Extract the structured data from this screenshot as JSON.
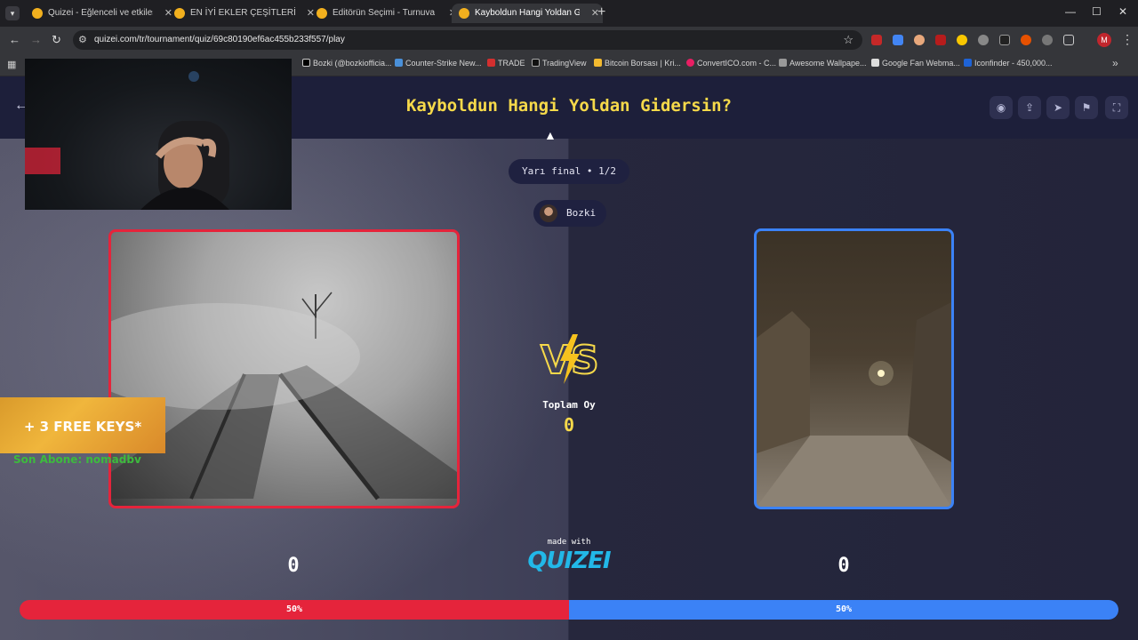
{
  "browser": {
    "tabs": [
      {
        "title": "Quizei - Eğlenceli ve etkileşimli",
        "active": false
      },
      {
        "title": "EN İYİ EKLER ÇEŞİTLERİ - Tier L",
        "active": false
      },
      {
        "title": "Editörün Seçimi - Turnuva - Qu",
        "active": false
      },
      {
        "title": "Kayboldun Hangi Yoldan Gider",
        "active": true
      }
    ],
    "url": "quizei.com/tr/tournament/quiz/69c80190ef6ac455b233f557/play",
    "profile_initial": "M",
    "bookmarks": [
      "Bozki (@bozkiofficia...",
      "Counter-Strike New...",
      "TRADE",
      "TradingView",
      "Bitcoin Borsası | Kri...",
      "ConvertICO.com - C...",
      "Awesome Wallpape...",
      "Google Fan Webma...",
      "Iconfinder - 450,000..."
    ]
  },
  "quiz": {
    "title": "Kayboldun Hangi Yoldan Gidersin?",
    "round_label": "Yarı final • 1/2",
    "creator": "Bozki",
    "total_votes_label": "Toplam Oy",
    "total_votes": "0",
    "made_with": "made with",
    "logo_text": "QUIZEI",
    "left": {
      "score": "0",
      "percent_label": "50%",
      "percent": 50
    },
    "right": {
      "score": "0",
      "percent_label": "50%",
      "percent": 50
    }
  },
  "overlay": {
    "promo": "+ 3 FREE KEYS*",
    "last_sub": "Son Abone: nomadbv"
  },
  "colors": {
    "left_accent": "#e5243b",
    "right_accent": "#3b82f6",
    "title_yellow": "#f6d94a",
    "logo_blue": "#22b8e8"
  }
}
